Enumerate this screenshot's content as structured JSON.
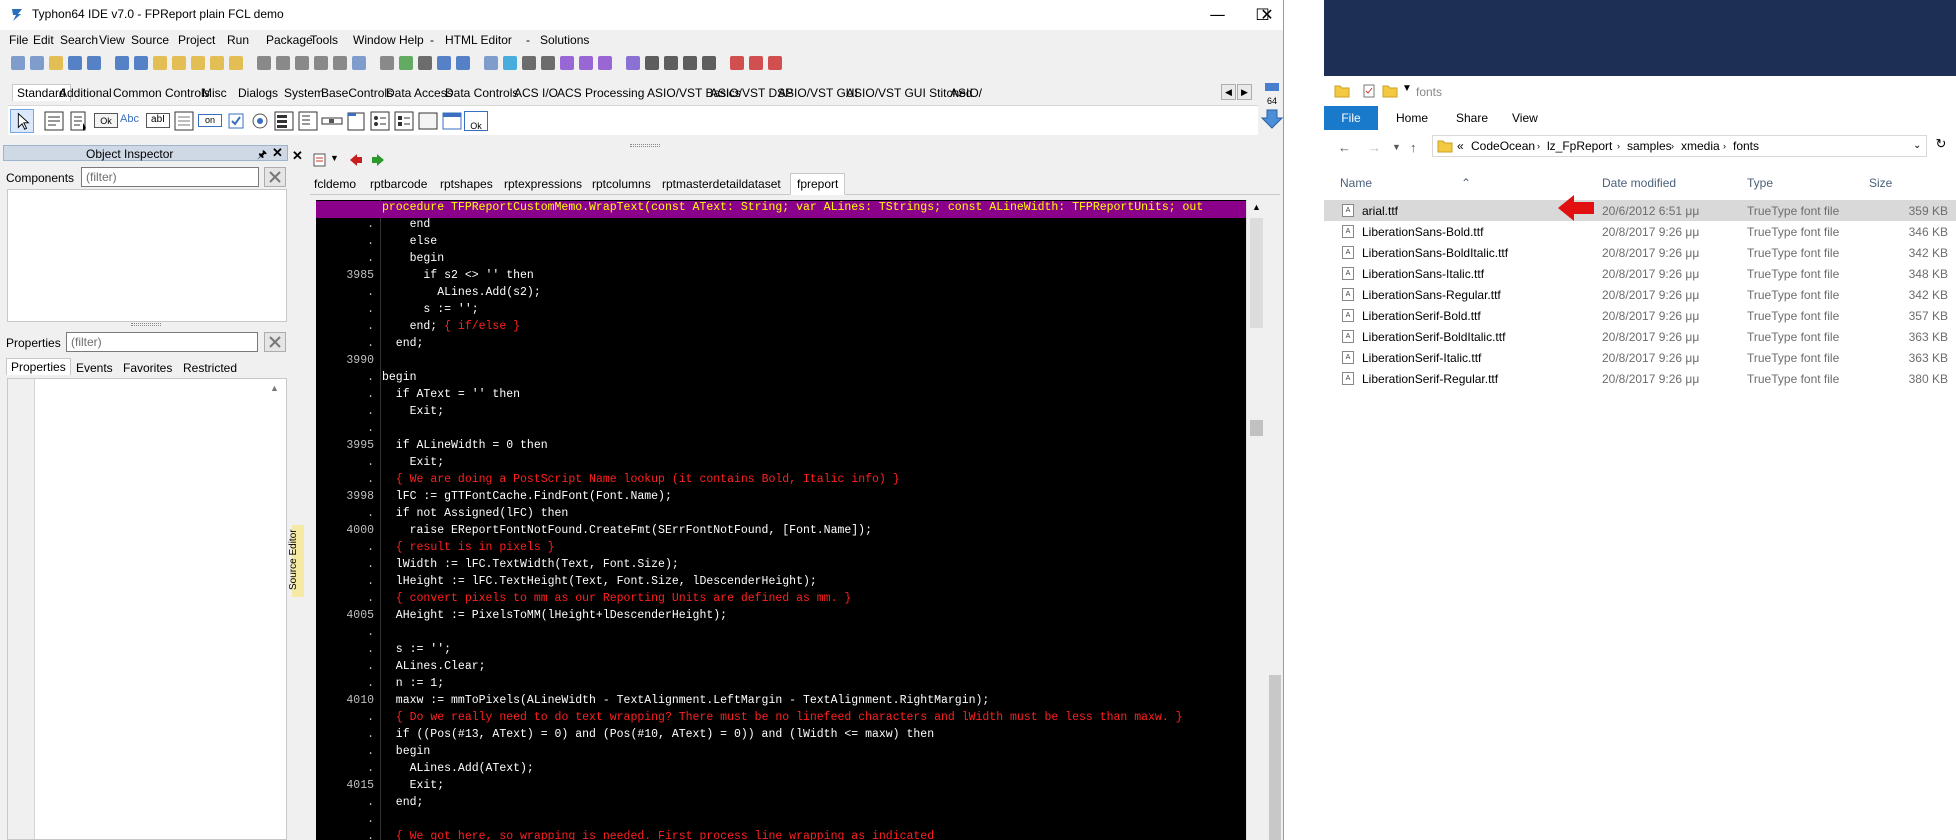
{
  "ide": {
    "title": "Typhon64 IDE v7.0 - FPReport plain FCL demo",
    "menu": [
      "File",
      "Edit",
      "Search",
      "View",
      "Source",
      "Project",
      "Run",
      "Package",
      "Tools",
      "Window",
      "Help",
      "-",
      "HTML Editor",
      "-",
      "Solutions"
    ],
    "palette_tabs": [
      "Standard",
      "Additional",
      "Common Controls",
      "Misc",
      "Dialogs",
      "System",
      "BaseControls",
      "Data Access",
      "Data Controls",
      "ACS I/O",
      "ACS Processing",
      "ASIO/VST Basics",
      "ASIO/VST DSP",
      "ASIO/VST GUI",
      "ASIO/VST GUI Stitched",
      "ASIO/"
    ],
    "badge_64": "64",
    "palette_labels": {
      "ok": "Ok",
      "abc": "Abc",
      "abl": "abI",
      "on": "on",
      "ok2": "Ok"
    }
  },
  "object_inspector": {
    "title": "Object Inspector",
    "components_label": "Components",
    "components_filter": "(filter)",
    "properties_label": "Properties",
    "properties_filter": "(filter)",
    "tabs": [
      "Properties",
      "Events",
      "Favorites",
      "Restricted"
    ]
  },
  "source_editor": {
    "side_label": "Source Editor",
    "tabs": [
      "fcldemo",
      "rptbarcode",
      "rptshapes",
      "rptexpressions",
      "rptcolumns",
      "rptmasterdetaildataset",
      "fpreport"
    ],
    "active_tab": "fpreport",
    "lines": [
      {
        "ln": "",
        "code": "procedure TFPReportCustomMemo.WrapText(const AText: String; var ALines: TStrings; const ALineWidth: TFPReportUnits; out",
        "hl": true
      },
      {
        "ln": ".",
        "code": "    end"
      },
      {
        "ln": ".",
        "code": "    else"
      },
      {
        "ln": ".",
        "code": "    begin"
      },
      {
        "ln": "3985",
        "code": "      if s2 <> '' then"
      },
      {
        "ln": ".",
        "code": "        ALines.Add(s2);"
      },
      {
        "ln": ".",
        "code": "      s := '';"
      },
      {
        "ln": ".",
        "code": "    end; ",
        "cmt": "{ if/else }"
      },
      {
        "ln": ".",
        "code": "  end;"
      },
      {
        "ln": "3990",
        "code": ""
      },
      {
        "ln": ".",
        "code": "begin"
      },
      {
        "ln": ".",
        "code": "  if AText = '' then"
      },
      {
        "ln": ".",
        "code": "    Exit;"
      },
      {
        "ln": ".",
        "code": ""
      },
      {
        "ln": "3995",
        "code": "  if ALineWidth = 0 then"
      },
      {
        "ln": ".",
        "code": "    Exit;"
      },
      {
        "ln": ".",
        "code": "  ",
        "cmt": "{ We are doing a PostScript Name lookup (it contains Bold, Italic info) }"
      },
      {
        "ln": "3998",
        "code": "  lFC := gTTFontCache.FindFont(Font.Name);"
      },
      {
        "ln": ".",
        "code": "  if not Assigned(lFC) then"
      },
      {
        "ln": "4000",
        "code": "    raise EReportFontNotFound.CreateFmt(SErrFontNotFound, [Font.Name]);"
      },
      {
        "ln": ".",
        "code": "  ",
        "cmt": "{ result is in pixels }"
      },
      {
        "ln": ".",
        "code": "  lWidth := lFC.TextWidth(Text, Font.Size);"
      },
      {
        "ln": ".",
        "code": "  lHeight := lFC.TextHeight(Text, Font.Size, lDescenderHeight);"
      },
      {
        "ln": ".",
        "code": "  ",
        "cmt": "{ convert pixels to mm as our Reporting Units are defined as mm. }"
      },
      {
        "ln": "4005",
        "code": "  AHeight := PixelsToMM(lHeight+lDescenderHeight);"
      },
      {
        "ln": ".",
        "code": ""
      },
      {
        "ln": ".",
        "code": "  s := '';"
      },
      {
        "ln": ".",
        "code": "  ALines.Clear;"
      },
      {
        "ln": ".",
        "code": "  n := 1;"
      },
      {
        "ln": "4010",
        "code": "  maxw := mmToPixels(ALineWidth - TextAlignment.LeftMargin - TextAlignment.RightMargin);"
      },
      {
        "ln": ".",
        "code": "  ",
        "cmt": "{ Do we really need to do text wrapping? There must be no linefeed characters and lWidth must be less than maxw. }"
      },
      {
        "ln": ".",
        "code": "  if ((Pos(#13, AText) = 0) and (Pos(#10, AText) = 0)) and (lWidth <= maxw) then"
      },
      {
        "ln": ".",
        "code": "  begin"
      },
      {
        "ln": ".",
        "code": "    ALines.Add(AText);"
      },
      {
        "ln": "4015",
        "code": "    Exit;"
      },
      {
        "ln": ".",
        "code": "  end;"
      },
      {
        "ln": ".",
        "code": ""
      },
      {
        "ln": ".",
        "code": "  ",
        "cmt": "{ We got here, so wrapping is needed. First process line wrapping as indicated"
      }
    ]
  },
  "explorer": {
    "title": "fonts",
    "ribbon": [
      "File",
      "Home",
      "Share",
      "View"
    ],
    "path": [
      "CodeOcean",
      "lz_FpReport",
      "samples",
      "xmedia",
      "fonts"
    ],
    "path_prefix": "«",
    "columns": [
      "Name",
      "Date modified",
      "Type",
      "Size"
    ],
    "files": [
      {
        "name": "arial.ttf",
        "date": "20/6/2012 6:51 μμ",
        "type": "TrueType font file",
        "size": "359 KB",
        "selected": true
      },
      {
        "name": "LiberationSans-Bold.ttf",
        "date": "20/8/2017 9:26 μμ",
        "type": "TrueType font file",
        "size": "346 KB"
      },
      {
        "name": "LiberationSans-BoldItalic.ttf",
        "date": "20/8/2017 9:26 μμ",
        "type": "TrueType font file",
        "size": "342 KB"
      },
      {
        "name": "LiberationSans-Italic.ttf",
        "date": "20/8/2017 9:26 μμ",
        "type": "TrueType font file",
        "size": "348 KB"
      },
      {
        "name": "LiberationSans-Regular.ttf",
        "date": "20/8/2017 9:26 μμ",
        "type": "TrueType font file",
        "size": "342 KB"
      },
      {
        "name": "LiberationSerif-Bold.ttf",
        "date": "20/8/2017 9:26 μμ",
        "type": "TrueType font file",
        "size": "357 KB"
      },
      {
        "name": "LiberationSerif-BoldItalic.ttf",
        "date": "20/8/2017 9:26 μμ",
        "type": "TrueType font file",
        "size": "363 KB"
      },
      {
        "name": "LiberationSerif-Italic.ttf",
        "date": "20/8/2017 9:26 μμ",
        "type": "TrueType font file",
        "size": "363 KB"
      },
      {
        "name": "LiberationSerif-Regular.ttf",
        "date": "20/8/2017 9:26 μμ",
        "type": "TrueType font file",
        "size": "380 KB"
      }
    ]
  },
  "colors": {
    "editor_bg": "#000000",
    "highlight_line": "#8b008b",
    "comment": "#ff2020",
    "explorer_file_tab": "#1979ca",
    "arrow": "#e01010"
  }
}
